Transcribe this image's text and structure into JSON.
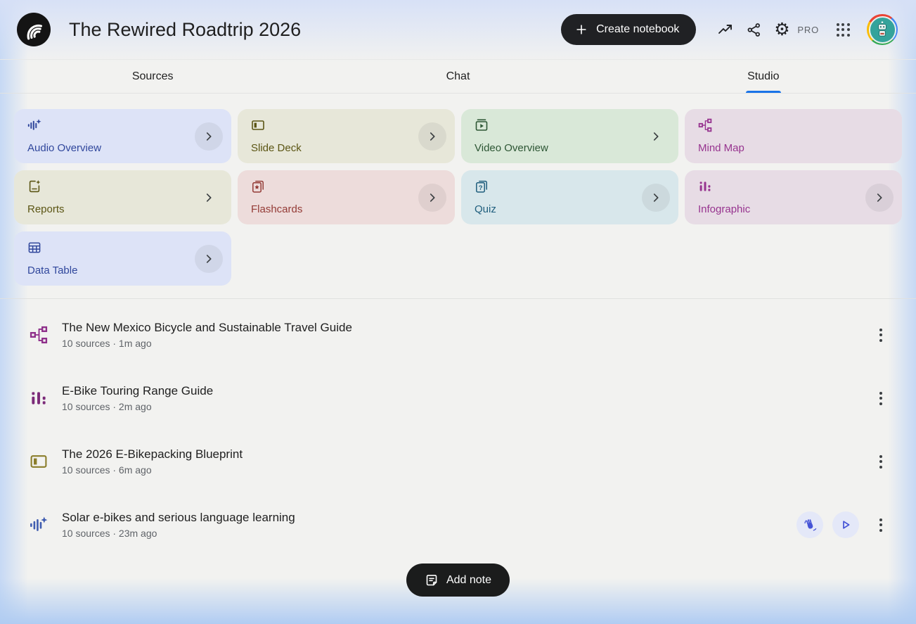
{
  "header": {
    "app_logo": "notebooklm-logo",
    "notebook_title": "The Rewired Roadtrip 2026",
    "create_notebook_label": "Create notebook",
    "pro_badge": "PRO"
  },
  "tabs": {
    "items": [
      {
        "label": "Sources",
        "active": false
      },
      {
        "label": "Chat",
        "active": false
      },
      {
        "label": "Studio",
        "active": true
      }
    ]
  },
  "studio_tools": [
    {
      "label": "Audio Overview",
      "icon": "audio-waveform-icon",
      "bg": "#dde3f7",
      "fg": "#30479c",
      "chevron": "circle"
    },
    {
      "label": "Slide Deck",
      "icon": "slide-deck-icon",
      "bg": "#e7e7d9",
      "fg": "#5b5514",
      "chevron": "circle"
    },
    {
      "label": "Video Overview",
      "icon": "video-overview-icon",
      "bg": "#d9e8d8",
      "fg": "#2d5634",
      "chevron": "plain"
    },
    {
      "label": "Mind Map",
      "icon": "mind-map-icon",
      "bg": "#e7dce5",
      "fg": "#97348f",
      "chevron": "none"
    },
    {
      "label": "Reports",
      "icon": "reports-icon",
      "bg": "#e7e7d9",
      "fg": "#5b5514",
      "chevron": "plain"
    },
    {
      "label": "Flashcards",
      "icon": "flashcards-icon",
      "bg": "#eddcdb",
      "fg": "#943b36",
      "chevron": "circle"
    },
    {
      "label": "Quiz",
      "icon": "quiz-icon",
      "bg": "#d8e7eb",
      "fg": "#1f5e7d",
      "chevron": "circle"
    },
    {
      "label": "Infographic",
      "icon": "infographic-icon",
      "bg": "#e7dce5",
      "fg": "#97348f",
      "chevron": "circle"
    },
    {
      "label": "Data Table",
      "icon": "data-table-icon",
      "bg": "#dde3f7",
      "fg": "#30479c",
      "chevron": "circle"
    }
  ],
  "artifacts": [
    {
      "icon": "mind-map-icon",
      "icon_color": "#8e2f8a",
      "title": "The New Mexico Bicycle and Sustainable Travel Guide",
      "meta": "10 sources · 1m ago",
      "actions": []
    },
    {
      "icon": "infographic-icon",
      "icon_color": "#7b2a78",
      "title": "E-Bike Touring Range Guide",
      "meta": "10 sources · 2m ago",
      "actions": []
    },
    {
      "icon": "slide-deck-icon",
      "icon_color": "#8a7d2a",
      "title": "The 2026 E-Bikepacking Blueprint",
      "meta": "10 sources · 6m ago",
      "actions": []
    },
    {
      "icon": "audio-waveform-icon",
      "icon_color": "#3f5cb0",
      "title": "Solar e-bikes and serious language learning",
      "meta": "10 sources · 23m ago",
      "actions": [
        "interactive-mode",
        "play"
      ]
    }
  ],
  "footer": {
    "add_note_label": "Add note"
  },
  "colors": {
    "accent_blue": "#1a73e8",
    "primary_button_bg": "#202124",
    "action_icon": "#4553d6",
    "action_circle_bg": "#e4e8f8"
  }
}
